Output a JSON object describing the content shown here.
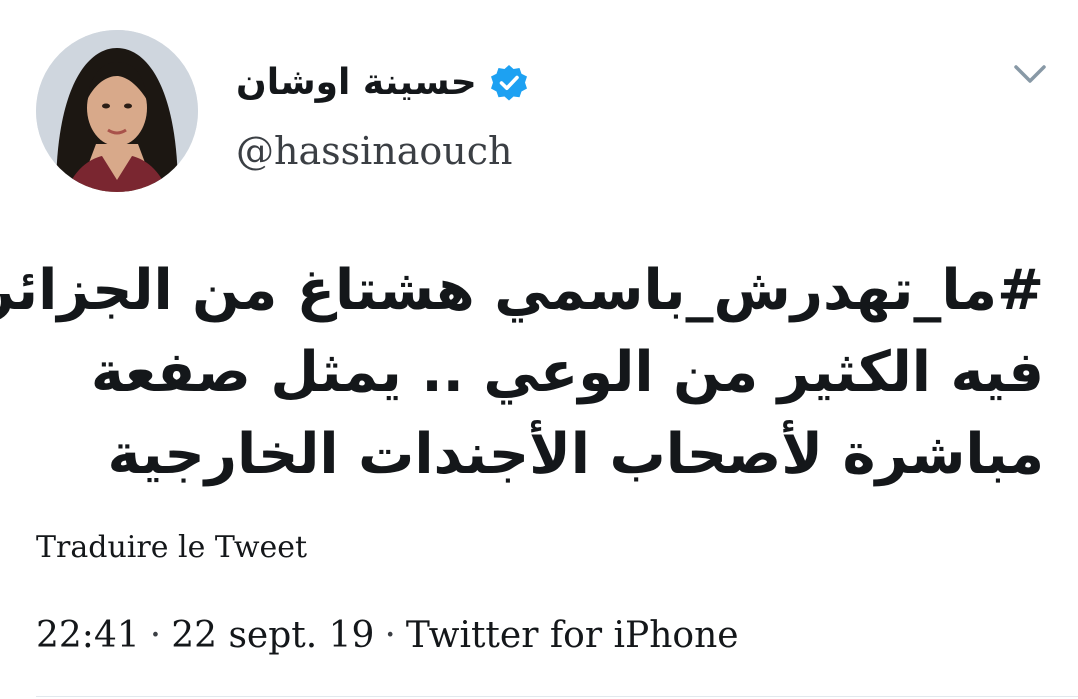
{
  "author": {
    "display_name": "حسينة اوشان",
    "handle": "@hassinaouch",
    "verified": true
  },
  "tweet": {
    "lines": [
      "#ما_تهدرش_باسمي هشتاغ من الجزائر",
      "فيه الكثير من الوعي .. يمثل صفعة",
      "مباشرة لأصحاب الأجندات الخارجية"
    ]
  },
  "translate_label": "Traduire le Tweet",
  "meta": {
    "time": "22:41",
    "date": "22 sept. 19",
    "source": "Twitter for iPhone",
    "separator": "·"
  },
  "icons": {
    "verified": "verified-badge-icon",
    "menu": "chevron-down-icon"
  },
  "colors": {
    "verified_blue": "#1da1f2",
    "text": "#14171a",
    "chevron": "#8899a6"
  }
}
